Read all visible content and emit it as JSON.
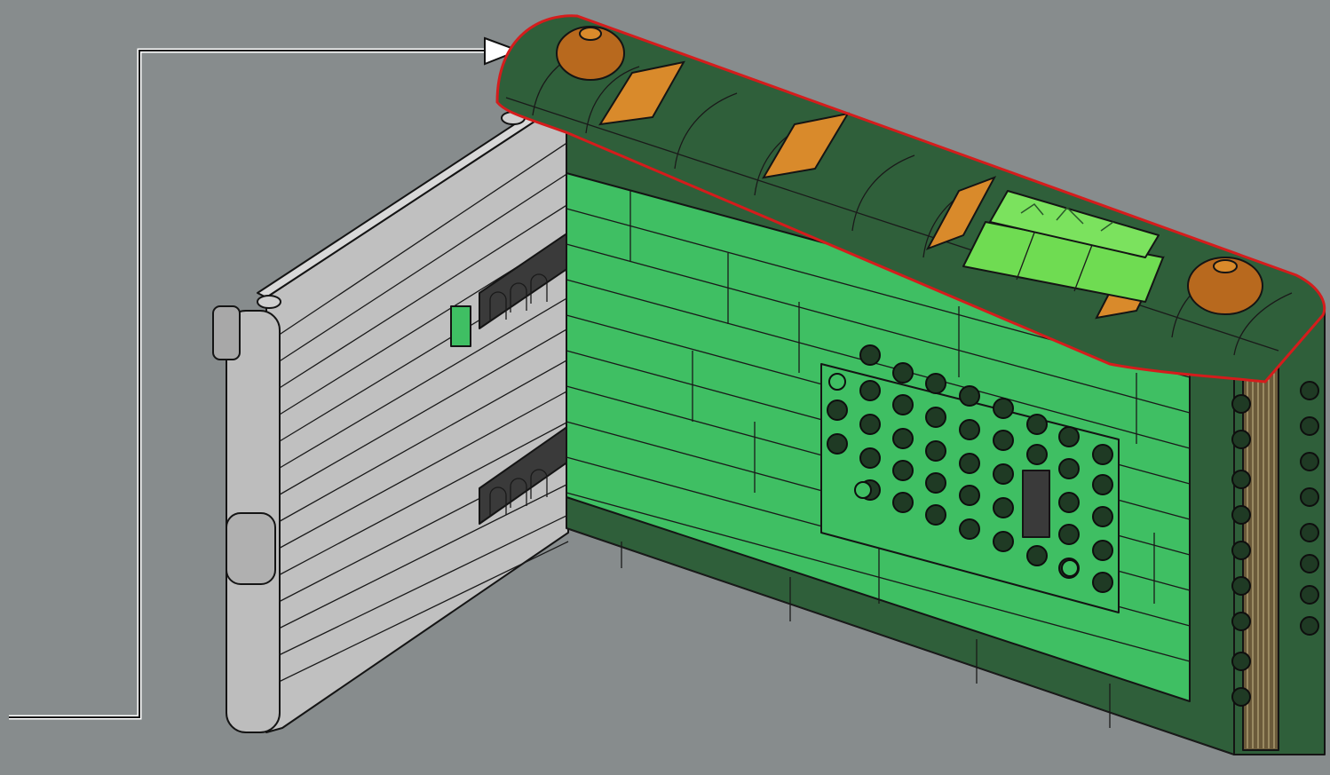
{
  "scene": {
    "subject": "lego-instruction-step",
    "callout_arrow": "arrow-right-icon",
    "highlight": "curved-top-roof-assembly"
  },
  "colors": {
    "background": "#878c8d",
    "dark_green": "#2f5f3a",
    "bright_green": "#3fbf63",
    "lime": "#6fdc52",
    "gray_brick": "#b8b8b8",
    "dark_gray": "#3a3a3a",
    "orange": "#d98a2b",
    "highlight_outline": "#d51c1c",
    "arrow": "#ffffff"
  }
}
